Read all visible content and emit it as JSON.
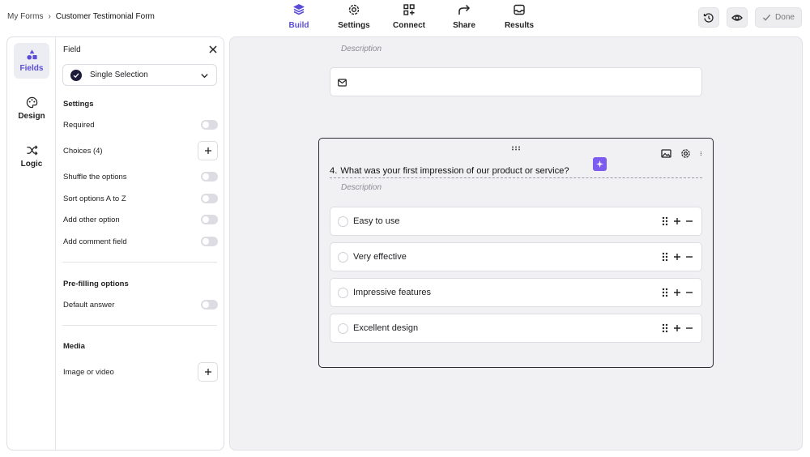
{
  "breadcrumb": {
    "parent": "My Forms",
    "separator": "›",
    "current": "Customer Testimonial Form"
  },
  "nav": {
    "tabs": [
      {
        "label": "Build",
        "icon": "layers-icon",
        "active": true
      },
      {
        "label": "Settings",
        "icon": "gear-icon"
      },
      {
        "label": "Connect",
        "icon": "connect-grid-icon"
      },
      {
        "label": "Share",
        "icon": "share-arrow-icon"
      },
      {
        "label": "Results",
        "icon": "inbox-icon"
      }
    ],
    "accent": "#5b4cd6"
  },
  "actions": {
    "history_icon": "history-icon",
    "preview_icon": "eye-icon",
    "done_label": "Done"
  },
  "rail": {
    "items": [
      {
        "label": "Fields",
        "icon": "shapes-icon",
        "active": true
      },
      {
        "label": "Design",
        "icon": "palette-icon"
      },
      {
        "label": "Logic",
        "icon": "shuffle-icon"
      }
    ]
  },
  "field_panel": {
    "title": "Field",
    "type_value": "Single Selection",
    "settings_heading": "Settings",
    "required_label": "Required",
    "choices_label": "Choices (4)",
    "shuffle_label": "Shuffle the options",
    "sort_label": "Sort options A to Z",
    "other_label": "Add other option",
    "comment_label": "Add comment field",
    "prefill_heading": "Pre-filling options",
    "default_label": "Default answer",
    "media_heading": "Media",
    "media_label": "Image or video"
  },
  "canvas": {
    "prev_description": "Description",
    "question": {
      "number": "4.",
      "title": "What was your first impression of our product or service?",
      "description": "Description",
      "options": [
        "Easy to use",
        "Very effective",
        "Impressive features",
        "Excellent design"
      ]
    }
  }
}
